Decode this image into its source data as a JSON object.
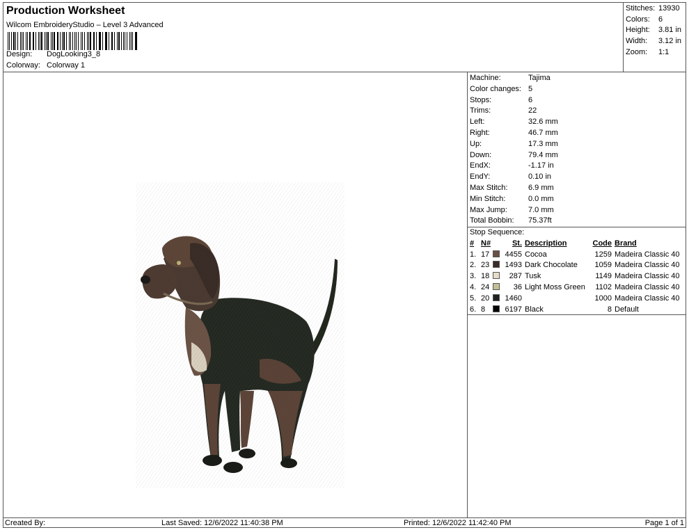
{
  "header": {
    "title": "Production Worksheet",
    "subtitle": "Wilcom EmbroideryStudio – Level 3 Advanced",
    "design_label": "Design:",
    "design_value": "DogLooking3_8",
    "colorway_label": "Colorway:",
    "colorway_value": "Colorway 1"
  },
  "summary": [
    {
      "label": "Stitches:",
      "value": "13930"
    },
    {
      "label": "Colors:",
      "value": "6"
    },
    {
      "label": "Height:",
      "value": "3.81 in"
    },
    {
      "label": "Width:",
      "value": "3.12 in"
    },
    {
      "label": "Zoom:",
      "value": "1:1"
    }
  ],
  "specs": [
    {
      "label": "Machine:",
      "value": "Tajima"
    },
    {
      "label": "Color changes:",
      "value": "5"
    },
    {
      "label": "Stops:",
      "value": "6"
    },
    {
      "label": "Trims:",
      "value": "22"
    },
    {
      "label": "Left:",
      "value": "32.6 mm"
    },
    {
      "label": "Right:",
      "value": "46.7 mm"
    },
    {
      "label": "Up:",
      "value": "17.3 mm"
    },
    {
      "label": "Down:",
      "value": "79.4 mm"
    },
    {
      "label": "EndX:",
      "value": "-1.17 in"
    },
    {
      "label": "EndY:",
      "value": "0.10 in"
    },
    {
      "label": "Max Stitch:",
      "value": "6.9 mm"
    },
    {
      "label": "Min Stitch:",
      "value": "0.0 mm"
    },
    {
      "label": "Max Jump:",
      "value": "7.0 mm"
    },
    {
      "label": "Total Bobbin:",
      "value": "75.37ft"
    }
  ],
  "stop_sequence": {
    "title": "Stop Sequence:",
    "columns": {
      "num": "#",
      "n": "N#",
      "st": "St.",
      "description": "Description",
      "code": "Code",
      "brand": "Brand"
    },
    "rows": [
      {
        "num": "1.",
        "n": "17",
        "color": "#6b4f45",
        "st": "4455",
        "description": "Cocoa",
        "code": "1259",
        "brand": "Madeira Classic 40"
      },
      {
        "num": "2.",
        "n": "23",
        "color": "#3a2a28",
        "st": "1493",
        "description": "Dark Chocolate",
        "code": "1059",
        "brand": "Madeira Classic 40"
      },
      {
        "num": "3.",
        "n": "18",
        "color": "#e7dcc6",
        "st": "287",
        "description": "Tusk",
        "code": "1149",
        "brand": "Madeira Classic 40"
      },
      {
        "num": "4.",
        "n": "24",
        "color": "#c2c093",
        "st": "36",
        "description": "Light Moss Green",
        "code": "1102",
        "brand": "Madeira Classic 40"
      },
      {
        "num": "5.",
        "n": "20",
        "color": "#1f2320",
        "st": "1460",
        "description": "",
        "code": "1000",
        "brand": "Madeira Classic 40"
      },
      {
        "num": "6.",
        "n": "8",
        "color": "#050505",
        "st": "6197",
        "description": "Black",
        "code": "8",
        "brand": "Default"
      }
    ]
  },
  "footer": {
    "created_by": "Created By:",
    "last_saved": "Last Saved: 12/6/2022 11:40:38 PM",
    "printed": "Printed: 12/6/2022 11:42:40 PM",
    "page": "Page 1 of 1"
  }
}
